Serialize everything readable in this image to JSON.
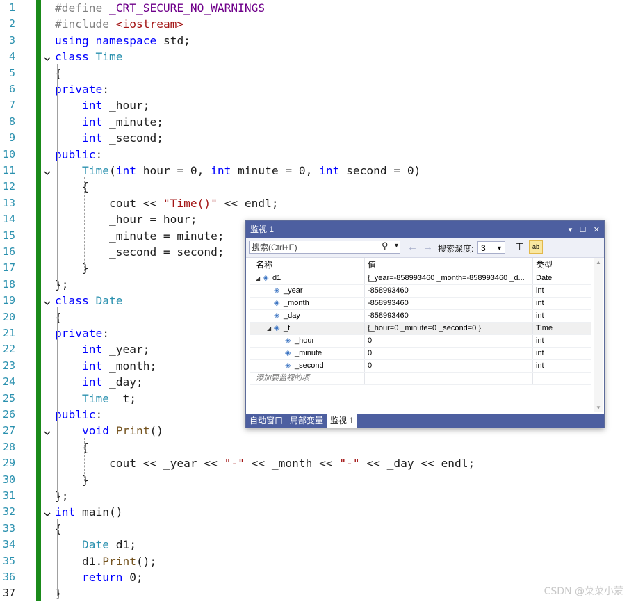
{
  "editor": {
    "current_line": 37,
    "lines": [
      {
        "n": "1",
        "segs": [
          [
            "pre",
            "#define "
          ],
          [
            "macro",
            "_CRT_SECURE_NO_WARNINGS"
          ]
        ]
      },
      {
        "n": "2",
        "segs": [
          [
            "pre",
            "#include "
          ],
          [
            "hdr",
            "<iostream>"
          ]
        ]
      },
      {
        "n": "3",
        "segs": [
          [
            "kw",
            "using"
          ],
          [
            "",
            ""
          ],
          [
            "kw",
            " namespace"
          ],
          [
            "",
            " std;"
          ]
        ]
      },
      {
        "n": "4",
        "fold": true,
        "segs": [
          [
            "kw",
            "class"
          ],
          [
            "",
            " "
          ],
          [
            "type",
            "Time"
          ]
        ]
      },
      {
        "n": "5",
        "segs": [
          [
            "",
            "{"
          ]
        ]
      },
      {
        "n": "6",
        "segs": [
          [
            "kw",
            "private"
          ],
          [
            "",
            ":"
          ]
        ]
      },
      {
        "n": "7",
        "segs": [
          [
            "",
            "    "
          ],
          [
            "kw",
            "int"
          ],
          [
            "",
            " _hour;"
          ]
        ]
      },
      {
        "n": "8",
        "segs": [
          [
            "",
            "    "
          ],
          [
            "kw",
            "int"
          ],
          [
            "",
            " _minute;"
          ]
        ]
      },
      {
        "n": "9",
        "segs": [
          [
            "",
            "    "
          ],
          [
            "kw",
            "int"
          ],
          [
            "",
            " _second;"
          ]
        ]
      },
      {
        "n": "10",
        "segs": [
          [
            "kw",
            "public"
          ],
          [
            "",
            ":"
          ]
        ]
      },
      {
        "n": "11",
        "fold": true,
        "segs": [
          [
            "",
            "    "
          ],
          [
            "type",
            "Time"
          ],
          [
            "",
            "("
          ],
          [
            "kw",
            "int"
          ],
          [
            "",
            " hour = 0, "
          ],
          [
            "kw",
            "int"
          ],
          [
            "",
            " minute = 0, "
          ],
          [
            "kw",
            "int"
          ],
          [
            "",
            " second = 0)"
          ]
        ]
      },
      {
        "n": "12",
        "segs": [
          [
            "",
            "    {"
          ]
        ]
      },
      {
        "n": "13",
        "segs": [
          [
            "",
            "        cout << "
          ],
          [
            "str",
            "\"Time()\""
          ],
          [
            "",
            " << endl;"
          ]
        ]
      },
      {
        "n": "14",
        "segs": [
          [
            "",
            "        _hour = hour;"
          ]
        ]
      },
      {
        "n": "15",
        "segs": [
          [
            "",
            "        _minute = minute;"
          ]
        ]
      },
      {
        "n": "16",
        "segs": [
          [
            "",
            "        _second = second;"
          ]
        ]
      },
      {
        "n": "17",
        "segs": [
          [
            "",
            "    }"
          ]
        ]
      },
      {
        "n": "18",
        "segs": [
          [
            "",
            "};"
          ]
        ]
      },
      {
        "n": "19",
        "fold": true,
        "segs": [
          [
            "kw",
            "class"
          ],
          [
            "",
            " "
          ],
          [
            "type",
            "Date"
          ]
        ]
      },
      {
        "n": "20",
        "segs": [
          [
            "",
            "{"
          ]
        ]
      },
      {
        "n": "21",
        "segs": [
          [
            "kw",
            "private"
          ],
          [
            "",
            ":"
          ]
        ]
      },
      {
        "n": "22",
        "segs": [
          [
            "",
            "    "
          ],
          [
            "kw",
            "int"
          ],
          [
            "",
            " _year;"
          ]
        ]
      },
      {
        "n": "23",
        "segs": [
          [
            "",
            "    "
          ],
          [
            "kw",
            "int"
          ],
          [
            "",
            " _month;"
          ]
        ]
      },
      {
        "n": "24",
        "segs": [
          [
            "",
            "    "
          ],
          [
            "kw",
            "int"
          ],
          [
            "",
            " _day;"
          ]
        ]
      },
      {
        "n": "25",
        "segs": [
          [
            "",
            "    "
          ],
          [
            "type",
            "Time"
          ],
          [
            "",
            " _t;"
          ]
        ]
      },
      {
        "n": "26",
        "segs": [
          [
            "kw",
            "public"
          ],
          [
            "",
            ":"
          ]
        ]
      },
      {
        "n": "27",
        "fold": true,
        "segs": [
          [
            "",
            "    "
          ],
          [
            "kw",
            "void"
          ],
          [
            "",
            " "
          ],
          [
            "fn",
            "Print"
          ],
          [
            "",
            "()"
          ]
        ]
      },
      {
        "n": "28",
        "segs": [
          [
            "",
            "    {"
          ]
        ]
      },
      {
        "n": "29",
        "segs": [
          [
            "",
            "        cout << _year << "
          ],
          [
            "str",
            "\"-\""
          ],
          [
            "",
            " << _month << "
          ],
          [
            "str",
            "\"-\""
          ],
          [
            "",
            " << _day << endl;"
          ]
        ]
      },
      {
        "n": "30",
        "segs": [
          [
            "",
            "    }"
          ]
        ]
      },
      {
        "n": "31",
        "segs": [
          [
            "",
            "};"
          ]
        ]
      },
      {
        "n": "32",
        "fold": true,
        "segs": [
          [
            "kw",
            "int"
          ],
          [
            "",
            " main()"
          ]
        ]
      },
      {
        "n": "33",
        "segs": [
          [
            "",
            "{"
          ]
        ]
      },
      {
        "n": "34",
        "segs": [
          [
            "",
            "    "
          ],
          [
            "type",
            "Date"
          ],
          [
            "",
            " d1;"
          ]
        ]
      },
      {
        "n": "35",
        "segs": [
          [
            "",
            "    d1."
          ],
          [
            "fn",
            "Print"
          ],
          [
            "",
            "();"
          ]
        ]
      },
      {
        "n": "36",
        "segs": [
          [
            "",
            "    "
          ],
          [
            "kw",
            "return"
          ],
          [
            "",
            " 0;"
          ]
        ]
      },
      {
        "n": "37",
        "segs": [
          [
            "",
            "}"
          ]
        ]
      }
    ]
  },
  "watch": {
    "title": "监视 1",
    "title_buttons": [
      "▾",
      "☐",
      "✕"
    ],
    "search_placeholder": "搜索(Ctrl+E)",
    "depth_label": "搜索深度:",
    "depth_value": "3",
    "columns": {
      "name": "名称",
      "value": "值",
      "type": "类型"
    },
    "rows": [
      {
        "indent": 0,
        "expander": "◢",
        "name": "d1",
        "value": "{_year=-858993460 _month=-858993460 _d...",
        "type": "Date",
        "icon": "object-icon"
      },
      {
        "indent": 1,
        "expander": "",
        "name": "_year",
        "value": "-858993460",
        "type": "int",
        "icon": "field-icon"
      },
      {
        "indent": 1,
        "expander": "",
        "name": "_month",
        "value": "-858993460",
        "type": "int",
        "icon": "field-icon"
      },
      {
        "indent": 1,
        "expander": "",
        "name": "_day",
        "value": "-858993460",
        "type": "int",
        "icon": "field-icon"
      },
      {
        "indent": 1,
        "expander": "◢",
        "name": "_t",
        "value": "{_hour=0 _minute=0 _second=0 }",
        "type": "Time",
        "icon": "field-icon",
        "selected": true
      },
      {
        "indent": 2,
        "expander": "",
        "name": "_hour",
        "value": "0",
        "type": "int",
        "icon": "field-icon"
      },
      {
        "indent": 2,
        "expander": "",
        "name": "_minute",
        "value": "0",
        "type": "int",
        "icon": "field-icon"
      },
      {
        "indent": 2,
        "expander": "",
        "name": "_second",
        "value": "0",
        "type": "int",
        "icon": "field-icon"
      }
    ],
    "add_item_text": "添加要监视的项",
    "tabs": [
      {
        "label": "自动窗口",
        "active": false
      },
      {
        "label": "局部变量",
        "active": false
      },
      {
        "label": "监视 1",
        "active": true
      }
    ]
  },
  "watermark": "CSDN @菜菜小蒙"
}
